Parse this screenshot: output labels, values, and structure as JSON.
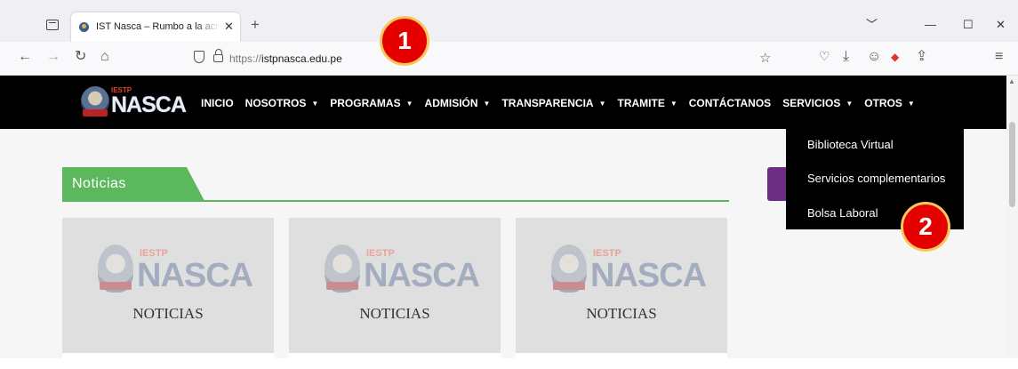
{
  "browser": {
    "tab": {
      "title": "IST Nasca – Rumbo a la acreditación",
      "close": "✕"
    },
    "new_tab": "+",
    "window_controls": {
      "list": "﹀",
      "minimize": "—",
      "maximize": "☐",
      "close": "✕"
    },
    "nav": {
      "back": "←",
      "forward": "→",
      "reload": "↻",
      "home": "⌂"
    },
    "url": {
      "protocol": "https://",
      "host": "istpnasca.edu.pe"
    },
    "toolbar_icons": {
      "bookmark": "☆",
      "pocket": "♡",
      "downloads": "⤓",
      "account": "☺",
      "extension": "◆",
      "share": "⇪",
      "menu": "≡"
    }
  },
  "annotations": {
    "badge1": "1",
    "badge2": "2"
  },
  "site": {
    "logo": {
      "small": "IESTP",
      "big": "NASCA"
    },
    "menu": [
      {
        "label": "INICIO",
        "caret": ""
      },
      {
        "label": "NOSOTROS",
        "caret": "▼"
      },
      {
        "label": "PROGRAMAS",
        "caret": "▼"
      },
      {
        "label": "ADMISIÓN",
        "caret": "▼"
      },
      {
        "label": "TRANSPARENCIA",
        "caret": "▼"
      },
      {
        "label": "TRAMITE",
        "caret": "▼"
      },
      {
        "label": "CONTÁCTANOS",
        "caret": ""
      },
      {
        "label": "SERVICIOS",
        "caret": "▼"
      },
      {
        "label": "OTROS",
        "caret": "▼"
      }
    ],
    "dropdown": [
      "Biblioteca Virtual",
      "Servicios complementarios",
      "Bolsa Laboral"
    ],
    "section_title": "Noticias",
    "cards": [
      {
        "iestp": "IESTP",
        "nasca": "NASCA",
        "caption": "NOTICIAS"
      },
      {
        "iestp": "IESTP",
        "nasca": "NASCA",
        "caption": "NOTICIAS"
      },
      {
        "iestp": "IESTP",
        "nasca": "NASCA",
        "caption": "NOTICIAS"
      }
    ]
  },
  "colors": {
    "accent_green": "#5cb85c",
    "nav_black": "#000000",
    "badge_red": "#e50000",
    "purple": "#6b2e82"
  }
}
